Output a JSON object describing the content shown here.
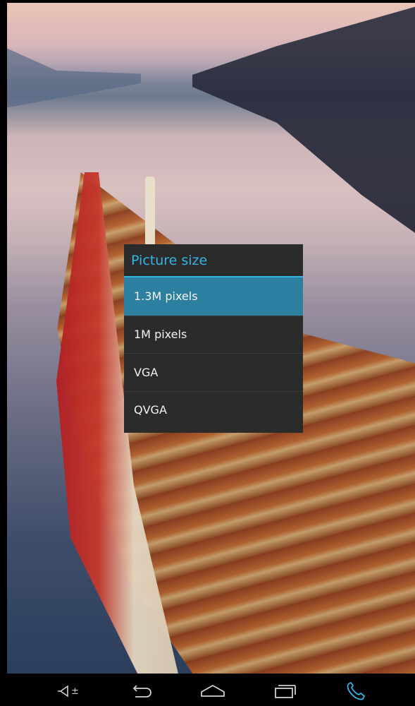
{
  "dialog": {
    "title": "Picture size",
    "options": [
      {
        "label": "1.3M pixels",
        "selected": true
      },
      {
        "label": "1M pixels",
        "selected": false
      },
      {
        "label": "VGA",
        "selected": false
      },
      {
        "label": "QVGA",
        "selected": false
      }
    ]
  },
  "navbar": {
    "volume_icon": "volume-down-icon",
    "back_icon": "back-icon",
    "home_icon": "home-icon",
    "recents_icon": "recent-apps-icon",
    "phone_icon": "phone-icon",
    "accent": "#33b5e5"
  }
}
